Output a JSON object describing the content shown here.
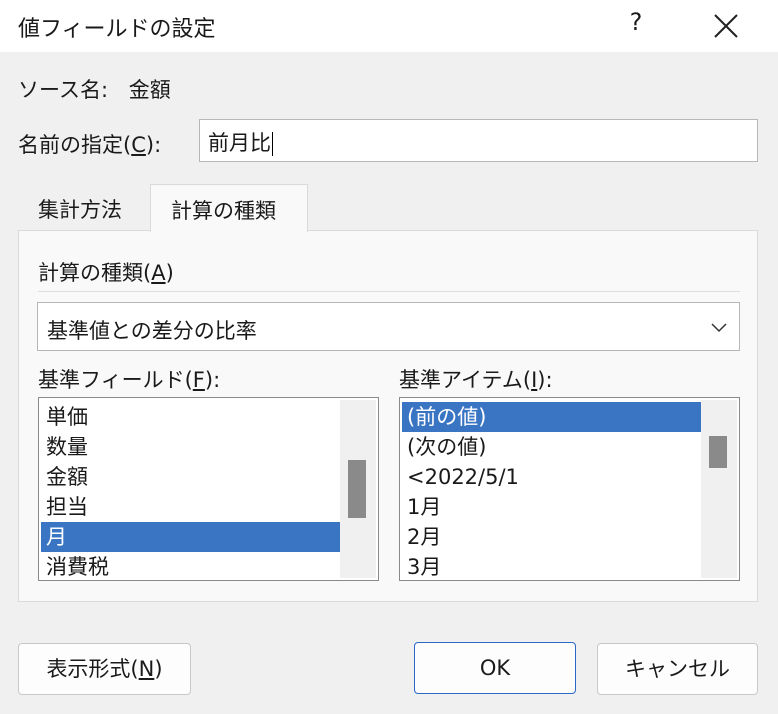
{
  "window": {
    "title": "値フィールドの設定",
    "help_label": "?"
  },
  "source": {
    "label": "ソース名:",
    "value": "金額"
  },
  "custom_name": {
    "label_prefix": "名前の指定(",
    "label_key": "C",
    "label_suffix": "):",
    "value": "前月比"
  },
  "tabs": [
    {
      "label": "集計方法",
      "active": false
    },
    {
      "label": "計算の種類",
      "active": true
    }
  ],
  "calc_type": {
    "label_prefix": "計算の種類(",
    "label_key": "A",
    "label_suffix": ")",
    "selected": "基準値との差分の比率"
  },
  "base_field": {
    "label_prefix": "基準フィールド(",
    "label_key": "F",
    "label_suffix": "):",
    "items": [
      "単価",
      "数量",
      "金額",
      "担当",
      "月",
      "消費税"
    ],
    "selected_index": 4
  },
  "base_item": {
    "label_prefix": "基準アイテム(",
    "label_key": "I",
    "label_suffix": "):",
    "items": [
      "(前の値)",
      "(次の値)",
      "<2022/5/1",
      "1月",
      "2月",
      "3月"
    ],
    "selected_index": 0
  },
  "buttons": {
    "number_format_prefix": "表示形式(",
    "number_format_key": "N",
    "number_format_suffix": ")",
    "ok": "OK",
    "cancel": "キャンセル"
  },
  "colors": {
    "selection": "#3a75c4",
    "ok_border": "#2b68c9"
  }
}
